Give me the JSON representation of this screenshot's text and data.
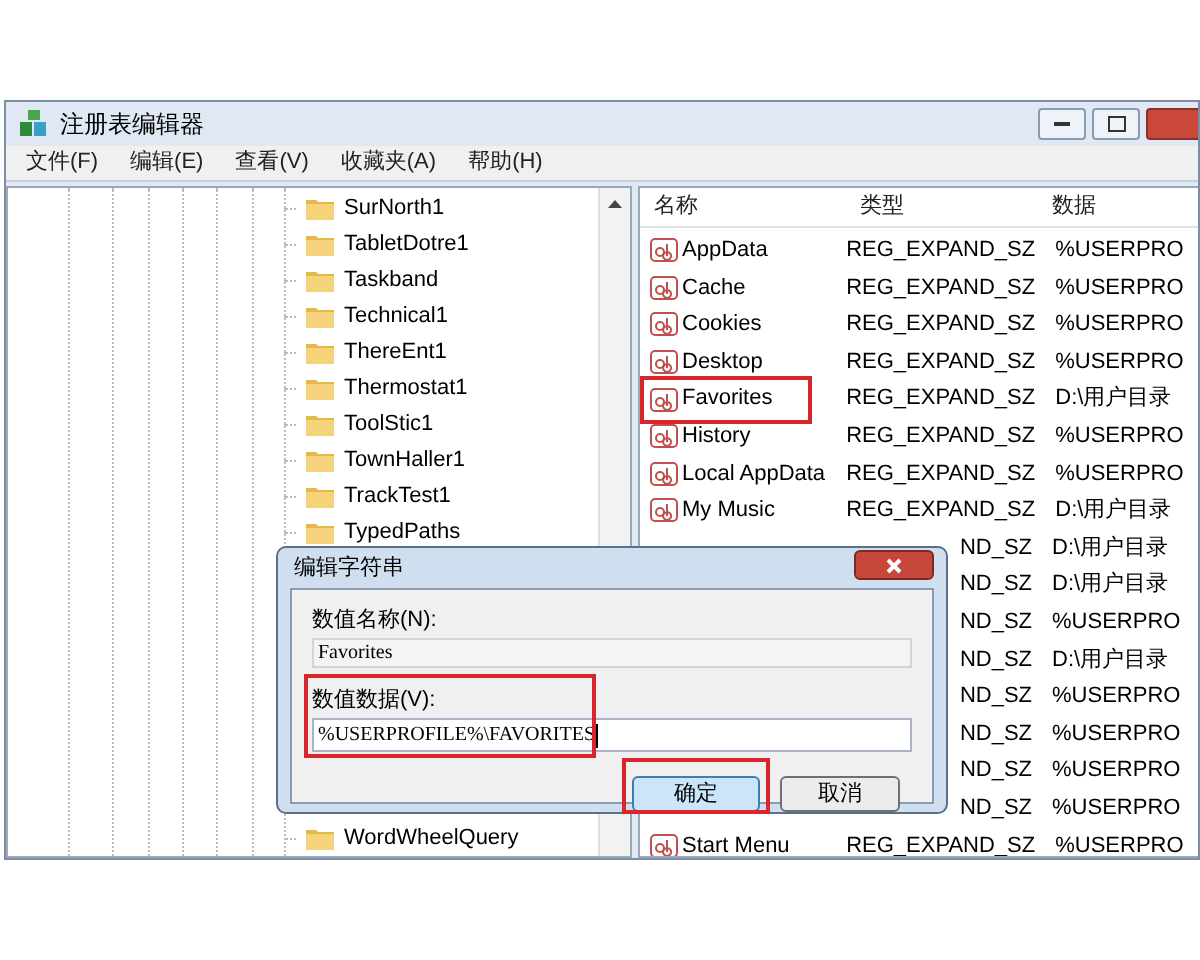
{
  "window": {
    "title": "注册表编辑器"
  },
  "menu": [
    "文件(F)",
    "编辑(E)",
    "查看(V)",
    "收藏夹(A)",
    "帮助(H)"
  ],
  "tree": {
    "items": [
      "SurNorth1",
      "TabletDotre1",
      "Taskband",
      "Technical1",
      "ThereEnt1",
      "Thermostat1",
      "ToolStic1",
      "TownHaller1",
      "TrackTest1",
      "TypedPaths"
    ],
    "items_below_dialog": [
      "WordWheelQuery"
    ]
  },
  "list": {
    "columns": [
      "名称",
      "类型",
      "数据"
    ],
    "rows": [
      {
        "name": "AppData",
        "type": "REG_EXPAND_SZ",
        "data": "%USERPRO",
        "highlighted": false
      },
      {
        "name": "Cache",
        "type": "REG_EXPAND_SZ",
        "data": "%USERPRO",
        "highlighted": false
      },
      {
        "name": "Cookies",
        "type": "REG_EXPAND_SZ",
        "data": "%USERPRO",
        "highlighted": false
      },
      {
        "name": "Desktop",
        "type": "REG_EXPAND_SZ",
        "data": "%USERPRO",
        "highlighted": false
      },
      {
        "name": "Favorites",
        "type": "REG_EXPAND_SZ",
        "data": "D:\\用户目录",
        "highlighted": true
      },
      {
        "name": "History",
        "type": "REG_EXPAND_SZ",
        "data": "%USERPRO",
        "highlighted": false
      },
      {
        "name": "Local AppData",
        "type": "REG_EXPAND_SZ",
        "data": "%USERPRO",
        "highlighted": false
      },
      {
        "name": "My Music",
        "type": "REG_EXPAND_SZ",
        "data": "D:\\用户目录",
        "highlighted": false
      },
      {
        "type": "ND_SZ",
        "data": "D:\\用户目录",
        "highlighted": false
      },
      {
        "type": "ND_SZ",
        "data": "D:\\用户目录",
        "highlighted": false
      },
      {
        "type": "ND_SZ",
        "data": "%USERPRO",
        "highlighted": false
      },
      {
        "type": "ND_SZ",
        "data": "D:\\用户目录",
        "highlighted": false
      },
      {
        "type": "ND_SZ",
        "data": "%USERPRO",
        "highlighted": false
      },
      {
        "type": "ND_SZ",
        "data": "%USERPRO",
        "highlighted": false
      },
      {
        "type": "ND_SZ",
        "data": "%USERPRO",
        "highlighted": false
      },
      {
        "type": "ND_SZ",
        "data": "%USERPRO",
        "highlighted": false
      },
      {
        "name": "Start Menu",
        "type": "REG_EXPAND_SZ",
        "data": "%USERPRO",
        "highlighted": false
      }
    ]
  },
  "dialog": {
    "title": "编辑字符串",
    "name_label": "数值名称(N):",
    "name_value": "Favorites",
    "data_label": "数值数据(V):",
    "data_value": "%USERPROFILE%\\FAVORITES",
    "data_highlighted": true,
    "buttons": [
      {
        "label": "确定",
        "default": true,
        "highlighted": true
      },
      {
        "label": "取消",
        "default": false,
        "highlighted": false
      }
    ]
  }
}
